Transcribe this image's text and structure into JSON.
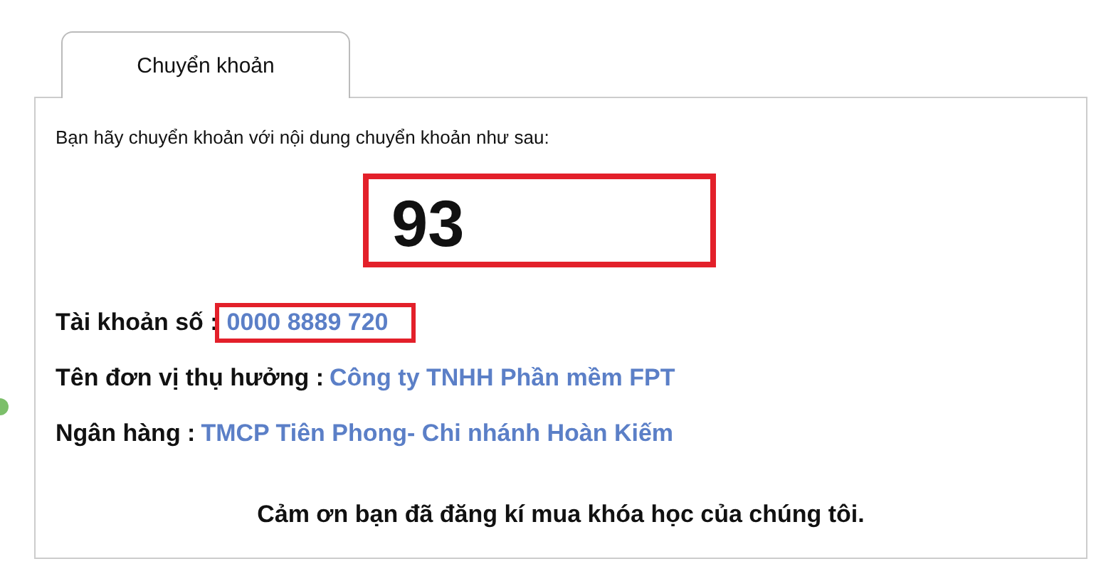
{
  "tabs": [
    {
      "label": "Chuyển khoản",
      "selected": true
    }
  ],
  "instruction": "Bạn hãy chuyển khoản với nội dung chuyển khoản như sau:",
  "transfer_code": "93",
  "details": [
    {
      "label": "Tài khoản số :",
      "value": "0000 8889 720",
      "highlighted": true
    },
    {
      "label": "Tên đơn vị thụ hưởng :",
      "value": "Công ty TNHH Phần mềm FPT",
      "highlighted": false
    },
    {
      "label": "Ngân hàng :",
      "value": "TMCP Tiên Phong- Chi nhánh Hoàn Kiếm",
      "highlighted": false
    }
  ],
  "thanks": "Cảm ơn bạn đã đăng kí mua khóa học của chúng tôi."
}
